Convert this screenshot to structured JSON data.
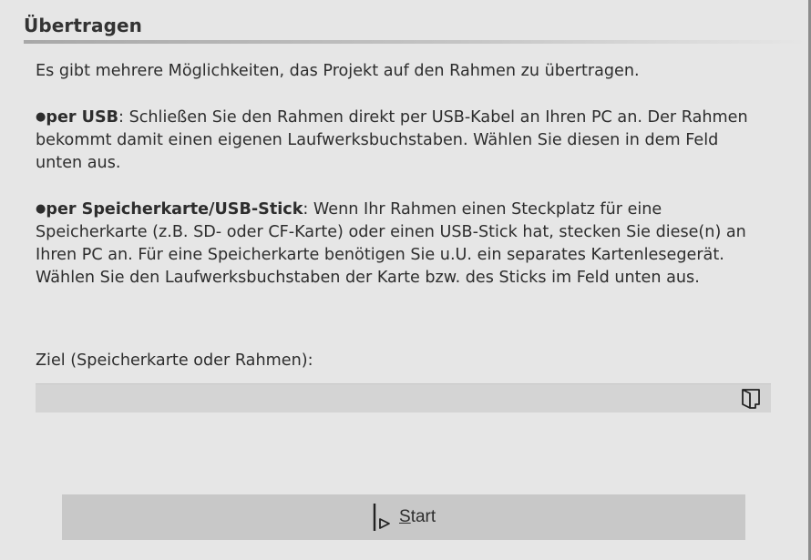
{
  "header": {
    "title": "Übertragen"
  },
  "content": {
    "intro": "Es gibt mehrere Möglichkeiten, das Projekt auf den Rahmen zu übertragen.",
    "bullets": [
      {
        "marker": "●",
        "title": "per USB",
        "text": ": Schließen Sie den Rahmen direkt per USB-Kabel an Ihren PC an. Der Rahmen bekommt damit einen eigenen Laufwerksbuchstaben. Wählen Sie diesen in dem Feld unten aus."
      },
      {
        "marker": "●",
        "title": "per Speicherkarte/USB-Stick",
        "text": ": Wenn Ihr Rahmen einen Steckplatz für eine Speicherkarte (z.B. SD- oder CF-Karte) oder einen USB-Stick hat, stecken Sie diese(n) an Ihren PC an. Für eine Speicherkarte benötigen Sie u.U. ein separates Kartenlesegerät. Wählen Sie den Laufwerksbuchstaben der Karte bzw. des Sticks im Feld unten aus."
      }
    ]
  },
  "ziel": {
    "label": "Ziel (Speicherkarte oder Rahmen):",
    "value": "",
    "browse_icon": "folder-browse-icon"
  },
  "start_button": {
    "mnemonic": "S",
    "label_rest": "tart",
    "icon": "play-start-icon"
  }
}
